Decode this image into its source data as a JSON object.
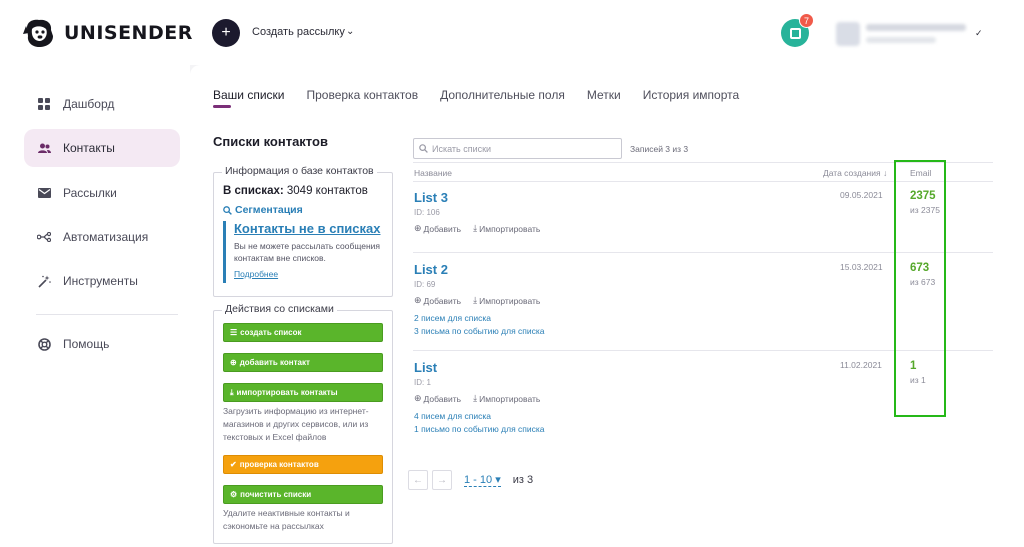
{
  "brand": {
    "name": "UNISENDER"
  },
  "topbar": {
    "create_label": "Создать рассылку",
    "notification_count": "7"
  },
  "sidebar": {
    "items": [
      {
        "label": "Дашборд",
        "icon": "dashboard-icon"
      },
      {
        "label": "Контакты",
        "icon": "contacts-icon",
        "active": true
      },
      {
        "label": "Рассылки",
        "icon": "mail-icon"
      },
      {
        "label": "Автоматизация",
        "icon": "automation-icon"
      },
      {
        "label": "Инструменты",
        "icon": "tools-icon"
      }
    ],
    "help": {
      "label": "Помощь",
      "icon": "help-icon"
    }
  },
  "tabs": [
    "Ваши списки",
    "Проверка контактов",
    "Дополнительные поля",
    "Метки",
    "История импорта"
  ],
  "section_title": "Списки контактов",
  "info_box": {
    "legend": "Информация о базе контактов",
    "count_label": "В списках:",
    "count_value": "3049 контактов",
    "segmentation": "Сегментация",
    "notice_title": "Контакты не в списках",
    "notice_text": "Вы не можете рассылать сообщения контактам вне списков.",
    "notice_more": "Подробнее"
  },
  "actions_box": {
    "legend": "Действия со списками",
    "create_list": "создать список",
    "add_contact": "добавить контакт",
    "import_contacts": "импортировать контакты",
    "import_desc": "Загрузить информацию из интернет-магазинов и других сервисов, или из текстовых и Excel файлов",
    "check_contacts": "проверка контактов",
    "clean_lists": "почистить списки",
    "clean_desc": "Удалите неактивные контакты и сэкономьте на рассылках"
  },
  "search": {
    "placeholder": "Искать списки"
  },
  "records": "Записей 3 из 3",
  "table": {
    "col_name": "Название",
    "col_date": "Дата создания ↓",
    "col_email": "Email",
    "add_label": "Добавить",
    "import_label": "Импортировать",
    "rows": [
      {
        "name": "List 3",
        "id": "ID: 106",
        "date": "09.05.2021",
        "email": "2375",
        "total": "из 2375",
        "links": []
      },
      {
        "name": "List 2",
        "id": "ID: 69",
        "date": "15.03.2021",
        "email": "673",
        "total": "из 673",
        "links": [
          "2 писем для списка",
          "3 письма по событию для списка"
        ]
      },
      {
        "name": "List",
        "id": "ID: 1",
        "date": "11.02.2021",
        "email": "1",
        "total": "из 1",
        "links": [
          "4 писем для списка",
          "1 письмо по событию для списка"
        ]
      }
    ]
  },
  "pager": {
    "range": "1 - 10",
    "of": "из 3"
  }
}
